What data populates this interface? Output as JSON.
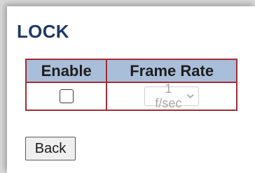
{
  "page": {
    "title": "LOCK"
  },
  "table": {
    "headers": {
      "enable": "Enable",
      "frame_rate": "Frame Rate"
    },
    "row": {
      "enable_checked": false,
      "frame_rate_value": "1 f/sec"
    }
  },
  "actions": {
    "back_label": "Back"
  },
  "colors": {
    "title": "#1f3a63",
    "header_bg": "#a9bed8",
    "border": "#a12d36",
    "disabled_text": "#a8a8a8"
  },
  "icons": {
    "select_chevron": "chevron-down-icon"
  }
}
